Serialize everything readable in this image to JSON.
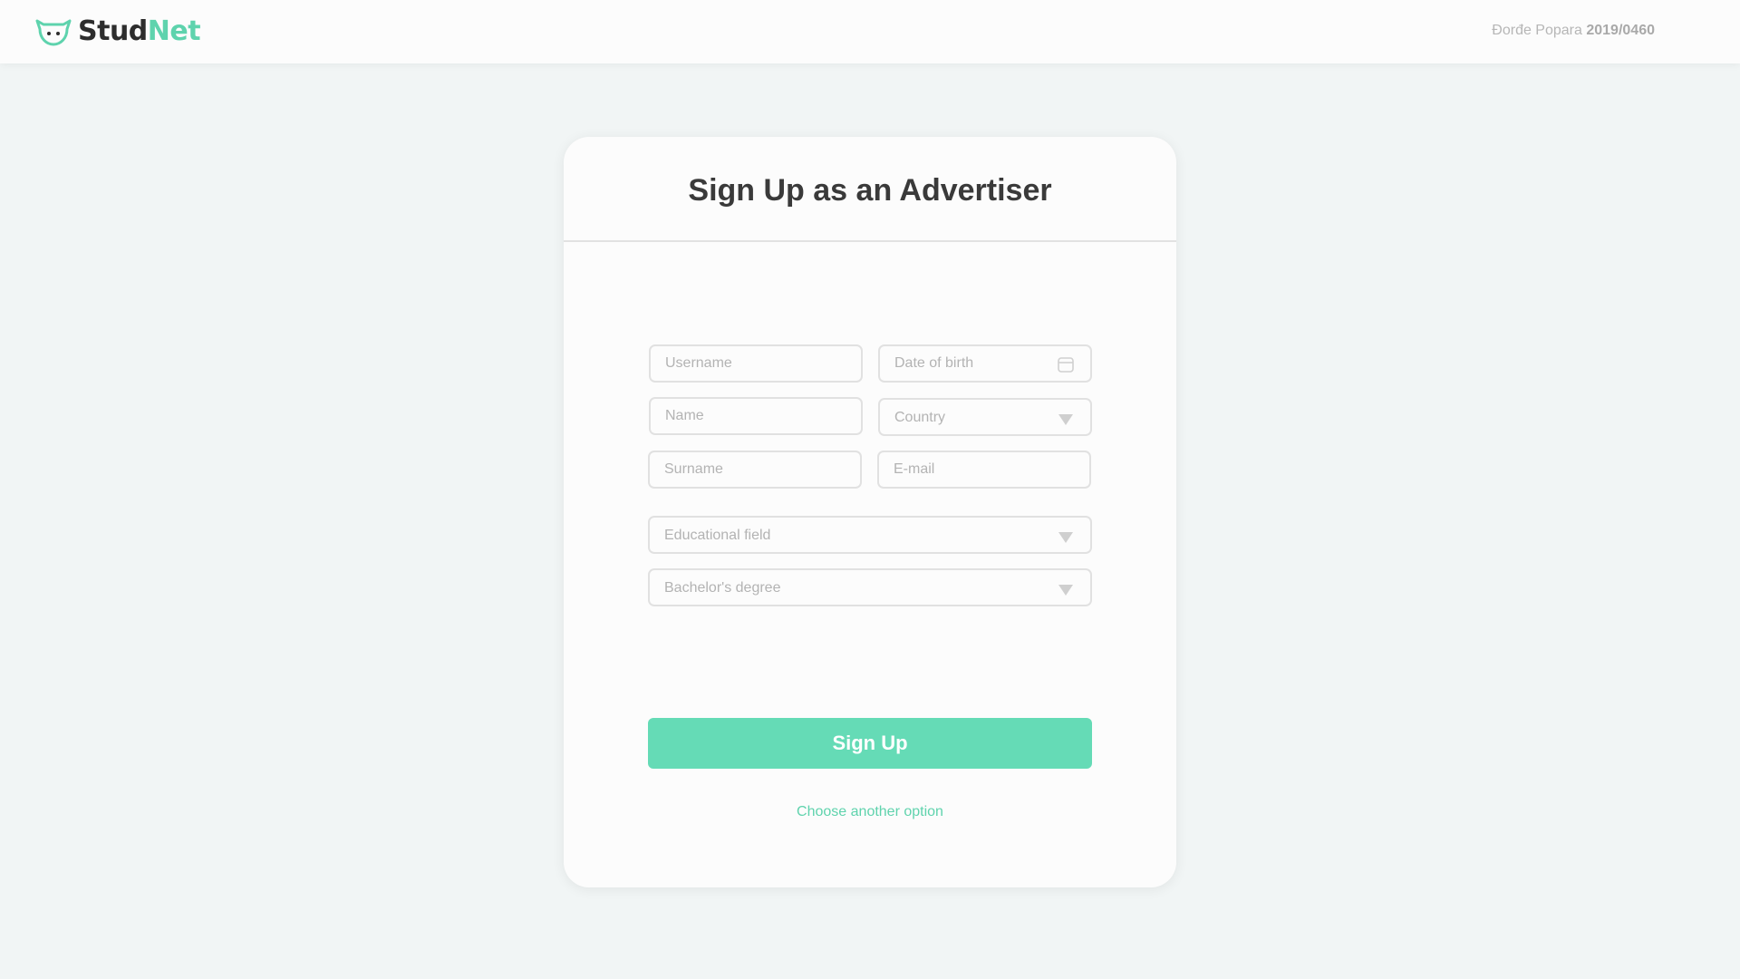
{
  "header": {
    "brand_dark": "Stud",
    "brand_green": "Net",
    "user_name": "Đorđe Popara",
    "user_id": "2019/0460"
  },
  "form": {
    "title": "Sign Up as an Advertiser",
    "username_placeholder": "Username",
    "dob_placeholder": "Date of birth",
    "name_placeholder": "Name",
    "country_placeholder": "Country",
    "surname_placeholder": "Surname",
    "email_placeholder": "E-mail",
    "educational_field_placeholder": "Educational field",
    "degree_placeholder": "Bachelor's degree",
    "submit_label": "Sign Up",
    "alt_link": "Choose another option"
  },
  "icons": {
    "logo": "studnet-logo-icon",
    "calendar": "calendar-icon",
    "dropdown": "chevron-down-icon"
  },
  "colors": {
    "accent": "#65dbb6",
    "brand_green": "#5ed3ad",
    "text_dark": "#3a3a3a",
    "background": "#f1f5f5"
  }
}
